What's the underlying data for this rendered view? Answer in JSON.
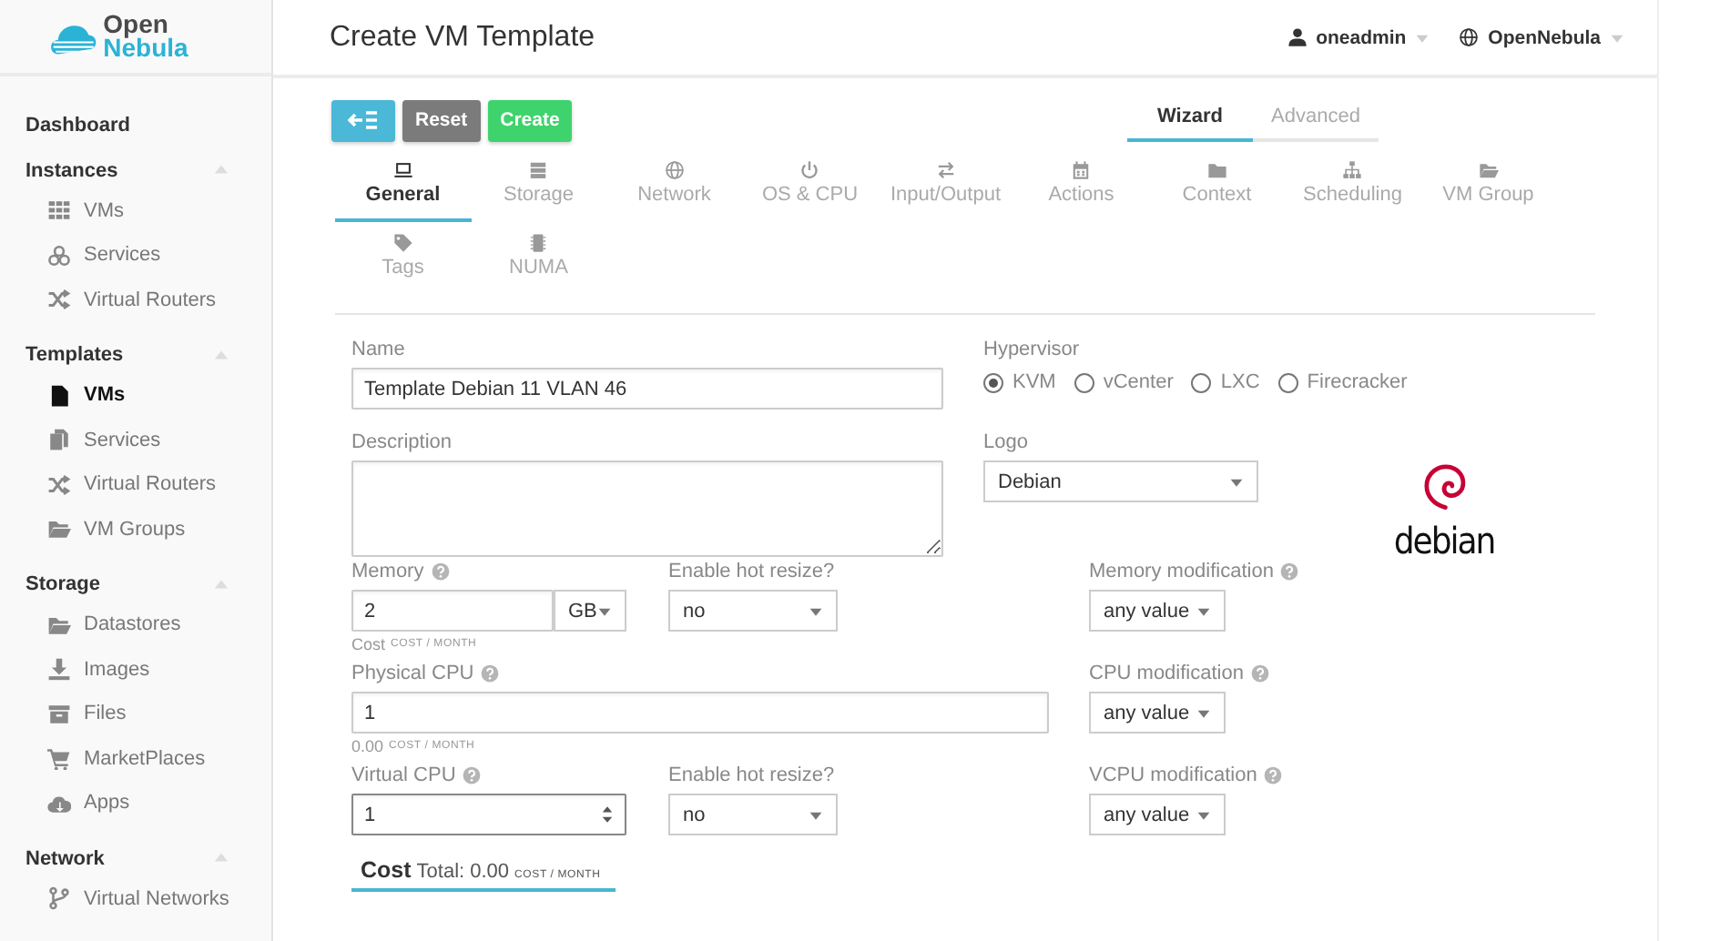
{
  "logo": {
    "line1": "Open",
    "line2": "Nebula"
  },
  "sidebar": {
    "items": [
      {
        "kind": "link",
        "label": "Dashboard"
      },
      {
        "kind": "section",
        "label": "Instances",
        "expanded": true,
        "children": [
          {
            "label": "VMs",
            "selected": false
          },
          {
            "label": "Services",
            "selected": false
          },
          {
            "label": "Virtual Routers",
            "selected": false
          }
        ]
      },
      {
        "kind": "section",
        "label": "Templates",
        "expanded": true,
        "children": [
          {
            "label": "VMs",
            "selected": true
          },
          {
            "label": "Services",
            "selected": false
          },
          {
            "label": "Virtual Routers",
            "selected": false
          },
          {
            "label": "VM Groups",
            "selected": false
          }
        ]
      },
      {
        "kind": "section",
        "label": "Storage",
        "expanded": true,
        "children": [
          {
            "label": "Datastores",
            "selected": false
          },
          {
            "label": "Images",
            "selected": false
          },
          {
            "label": "Files",
            "selected": false
          },
          {
            "label": "MarketPlaces",
            "selected": false
          },
          {
            "label": "Apps",
            "selected": false
          }
        ]
      },
      {
        "kind": "section",
        "label": "Network",
        "expanded": true,
        "children": [
          {
            "label": "Virtual Networks",
            "selected": false
          }
        ]
      }
    ]
  },
  "header": {
    "title": "Create VM Template",
    "user": "oneadmin",
    "zone": "OpenNebula"
  },
  "toolbar": {
    "buttons": [
      {
        "kind": "back"
      },
      {
        "kind": "reset",
        "label": "Reset"
      },
      {
        "kind": "create",
        "label": "Create"
      }
    ]
  },
  "mode_tabs": [
    {
      "label": "Wizard",
      "selected": true
    },
    {
      "label": "Advanced",
      "selected": false
    }
  ],
  "tabs": [
    {
      "label": "General",
      "selected": true
    },
    {
      "label": "Storage",
      "selected": false
    },
    {
      "label": "Network",
      "selected": false
    },
    {
      "label": "OS & CPU",
      "selected": false
    },
    {
      "label": "Input/Output",
      "selected": false
    },
    {
      "label": "Actions",
      "selected": false
    },
    {
      "label": "Context",
      "selected": false
    },
    {
      "label": "Scheduling",
      "selected": false
    },
    {
      "label": "VM Group",
      "selected": false
    },
    {
      "label": "Tags",
      "selected": false
    },
    {
      "label": "NUMA",
      "selected": false
    }
  ],
  "form": {
    "name": {
      "label": "Name",
      "value": "Template Debian 11 VLAN 46"
    },
    "hypervisor": {
      "label": "Hypervisor",
      "options": [
        {
          "label": "KVM",
          "selected": true
        },
        {
          "label": "vCenter",
          "selected": false
        },
        {
          "label": "LXC",
          "selected": false
        },
        {
          "label": "Firecracker",
          "selected": false
        }
      ]
    },
    "description": {
      "label": "Description"
    },
    "logo": {
      "label": "Logo",
      "value": "Debian",
      "preview_text": "debian"
    },
    "memory": {
      "label": "Memory",
      "value": "2",
      "unit": "GB",
      "cost": "Cost",
      "cost_unit": "COST / MONTH"
    },
    "memory_hot_resize": {
      "label": "Enable hot resize?",
      "value": "no"
    },
    "memory_modification": {
      "label": "Memory modification",
      "value": "any value"
    },
    "physical_cpu": {
      "label": "Physical CPU",
      "value": "1",
      "cost": "0.00",
      "cost_unit": "COST / MONTH"
    },
    "cpu_modification": {
      "label": "CPU modification",
      "value": "any value"
    },
    "virtual_cpu": {
      "label": "Virtual CPU",
      "value": "1",
      "focused": true
    },
    "vcpu_hot_resize": {
      "label": "Enable hot resize?",
      "value": "no"
    },
    "vcpu_modification": {
      "label": "VCPU modification",
      "value": "any value"
    },
    "cost_summary": {
      "title": "Cost",
      "total": "Total: 0.00",
      "unit": "COST / MONTH"
    }
  }
}
